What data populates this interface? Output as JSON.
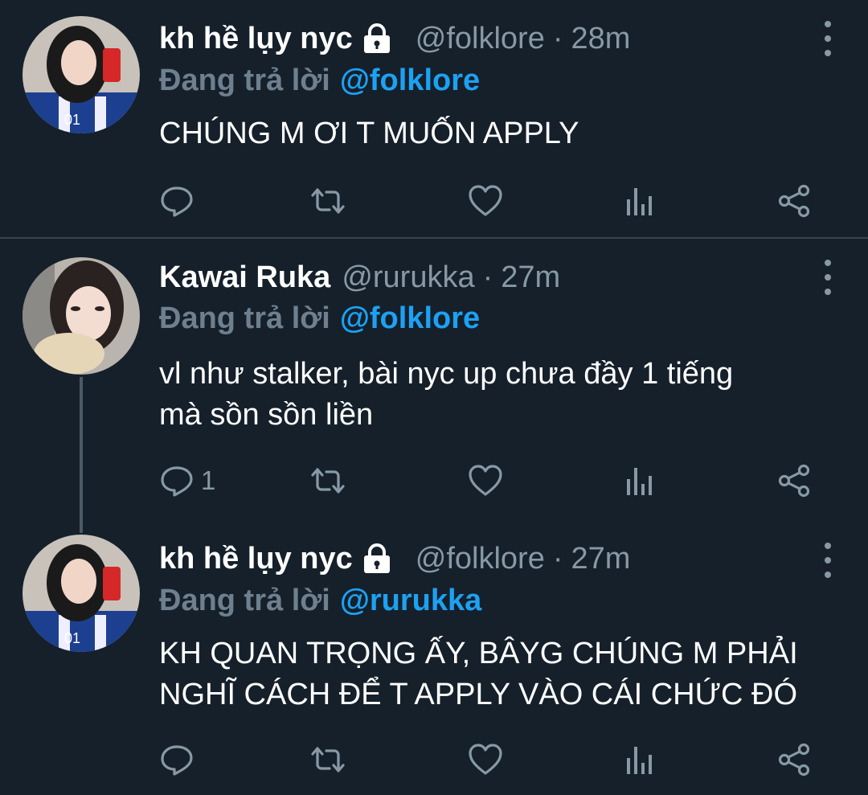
{
  "tweets": [
    {
      "name": "kh hề lụy nyc",
      "protected": true,
      "handle": "@folklore",
      "separator": "·",
      "time": "28m",
      "reply_prefix": "Đang trả lời",
      "reply_to": "@folklore",
      "lines": [
        "CHÚNG M ƠI T MUỐN APPLY"
      ],
      "reply_count": ""
    },
    {
      "name": "Kawai Ruka",
      "protected": false,
      "handle": "@rurukka",
      "separator": "·",
      "time": "27m",
      "reply_prefix": "Đang trả lời",
      "reply_to": "@folklore",
      "lines": [
        "vl như stalker, bài nyc up chưa đầy 1 tiếng",
        "mà sồn sồn liền"
      ],
      "reply_count": "1"
    },
    {
      "name": "kh hề lụy nyc",
      "protected": true,
      "handle": "@folklore",
      "separator": "·",
      "time": "27m",
      "reply_prefix": "Đang trả lời",
      "reply_to": "@rurukka",
      "lines": [
        "KH QUAN TRỌNG ẤY, BÂYG CHÚNG M PHẢI",
        "NGHĨ CÁCH ĐỂ T APPLY VÀO CÁI CHỨC ĐÓ"
      ],
      "reply_count": ""
    }
  ],
  "icons": [
    "reply-icon",
    "retweet-icon",
    "like-icon",
    "analytics-icon",
    "share-icon",
    "more-icon",
    "lock-icon"
  ],
  "colors": {
    "background": "#15202b",
    "secondary_text": "#8899a6",
    "mention": "#1da1f2",
    "divider": "#38444d"
  }
}
